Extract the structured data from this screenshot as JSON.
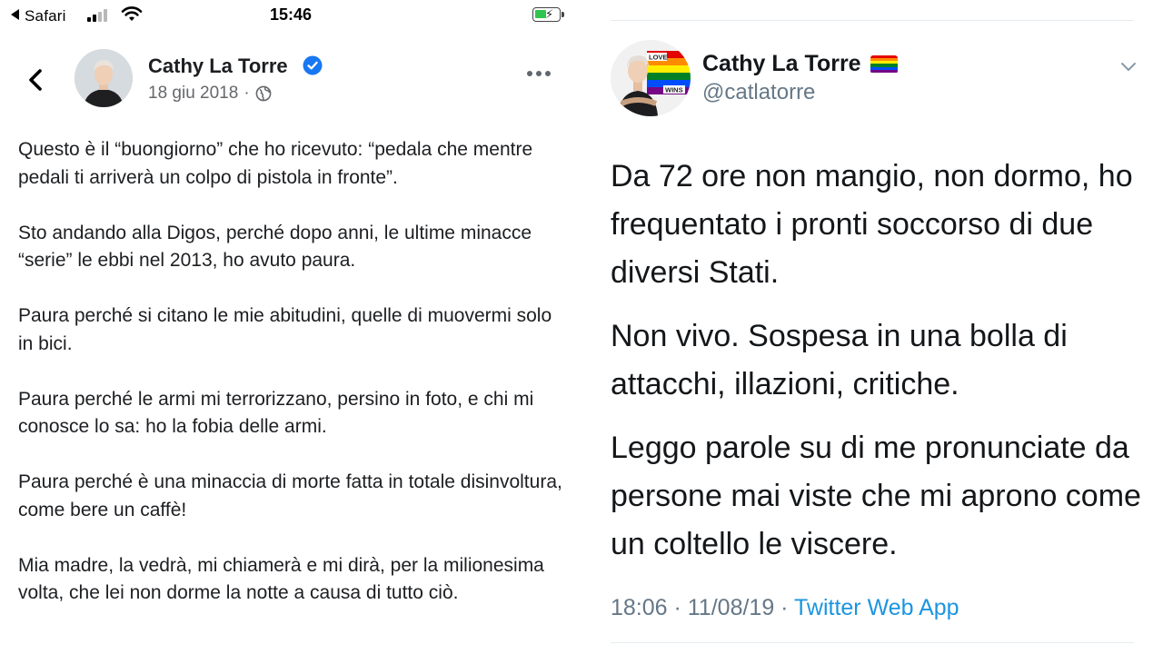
{
  "status_bar": {
    "back_app": "Safari",
    "time": "15:46"
  },
  "facebook_post": {
    "author": "Cathy La Torre",
    "date": "18 giu 2018",
    "separator": "·",
    "paragraphs": [
      "Questo è il “buongiorno” che ho ricevuto: “pedala che mentre pedali ti arriverà un colpo di pistola in fronte”.",
      "Sto andando alla Digos, perché dopo anni, le ultime minacce “serie” le ebbi nel 2013, ho avuto paura.",
      "Paura perché si citano le mie abitudini, quelle di muovermi solo in bici.",
      "Paura perché le armi mi terrorizzano, persino in foto, e chi mi conosce lo sa: ho la fobia delle armi.",
      "Paura perché è una minaccia di morte fatta in totale disinvoltura, come bere un caffè!",
      "Mia madre, la vedrà, mi chiamerà e mi dirà, per la milionesima volta, che lei non dorme la notte a causa di tutto ciò."
    ]
  },
  "tweet": {
    "author": "Cathy La Torre",
    "handle": "@catlatorre",
    "avatar_banner": [
      "LOVE",
      "WINS"
    ],
    "paragraphs": [
      "Da 72 ore non mangio, non dormo, ho frequentato i pronti soccorso di due diversi Stati.",
      "Non vivo. Sospesa in una bolla di attacchi, illazioni, critiche.",
      "Leggo parole su di me pronunciate da persone mai viste che mi aprono come un coltello le viscere."
    ],
    "timestamp": "18:06 · 11/08/19 · ",
    "source": "Twitter Web App"
  },
  "icons": {
    "back": "chevron-left-icon",
    "verified": "verified-badge-icon",
    "globe": "globe-icon",
    "more": "more-dots-icon",
    "caret": "chevron-down-icon",
    "flag": "rainbow-flag-icon"
  },
  "colors": {
    "facebook_text": "#1c1e21",
    "facebook_meta": "#65676b",
    "verified_blue": "#1877f2",
    "twitter_text": "#14171a",
    "twitter_meta": "#657786",
    "twitter_link": "#1b95e0",
    "battery_green": "#2fc44f"
  }
}
